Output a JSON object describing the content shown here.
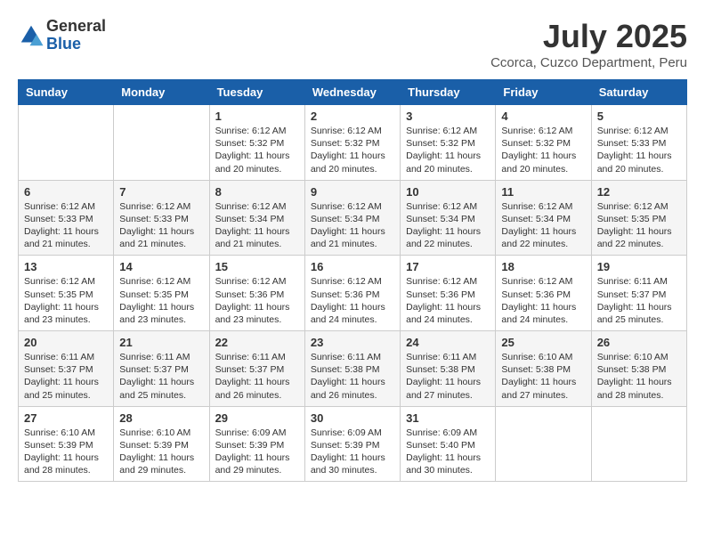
{
  "header": {
    "logo": {
      "general": "General",
      "blue": "Blue"
    },
    "month": "July 2025",
    "location": "Ccorca, Cuzco Department, Peru"
  },
  "weekdays": [
    "Sunday",
    "Monday",
    "Tuesday",
    "Wednesday",
    "Thursday",
    "Friday",
    "Saturday"
  ],
  "weeks": [
    [
      {
        "day": "",
        "info": ""
      },
      {
        "day": "",
        "info": ""
      },
      {
        "day": "1",
        "info": "Sunrise: 6:12 AM\nSunset: 5:32 PM\nDaylight: 11 hours and 20 minutes."
      },
      {
        "day": "2",
        "info": "Sunrise: 6:12 AM\nSunset: 5:32 PM\nDaylight: 11 hours and 20 minutes."
      },
      {
        "day": "3",
        "info": "Sunrise: 6:12 AM\nSunset: 5:32 PM\nDaylight: 11 hours and 20 minutes."
      },
      {
        "day": "4",
        "info": "Sunrise: 6:12 AM\nSunset: 5:32 PM\nDaylight: 11 hours and 20 minutes."
      },
      {
        "day": "5",
        "info": "Sunrise: 6:12 AM\nSunset: 5:33 PM\nDaylight: 11 hours and 20 minutes."
      }
    ],
    [
      {
        "day": "6",
        "info": "Sunrise: 6:12 AM\nSunset: 5:33 PM\nDaylight: 11 hours and 21 minutes."
      },
      {
        "day": "7",
        "info": "Sunrise: 6:12 AM\nSunset: 5:33 PM\nDaylight: 11 hours and 21 minutes."
      },
      {
        "day": "8",
        "info": "Sunrise: 6:12 AM\nSunset: 5:34 PM\nDaylight: 11 hours and 21 minutes."
      },
      {
        "day": "9",
        "info": "Sunrise: 6:12 AM\nSunset: 5:34 PM\nDaylight: 11 hours and 21 minutes."
      },
      {
        "day": "10",
        "info": "Sunrise: 6:12 AM\nSunset: 5:34 PM\nDaylight: 11 hours and 22 minutes."
      },
      {
        "day": "11",
        "info": "Sunrise: 6:12 AM\nSunset: 5:34 PM\nDaylight: 11 hours and 22 minutes."
      },
      {
        "day": "12",
        "info": "Sunrise: 6:12 AM\nSunset: 5:35 PM\nDaylight: 11 hours and 22 minutes."
      }
    ],
    [
      {
        "day": "13",
        "info": "Sunrise: 6:12 AM\nSunset: 5:35 PM\nDaylight: 11 hours and 23 minutes."
      },
      {
        "day": "14",
        "info": "Sunrise: 6:12 AM\nSunset: 5:35 PM\nDaylight: 11 hours and 23 minutes."
      },
      {
        "day": "15",
        "info": "Sunrise: 6:12 AM\nSunset: 5:36 PM\nDaylight: 11 hours and 23 minutes."
      },
      {
        "day": "16",
        "info": "Sunrise: 6:12 AM\nSunset: 5:36 PM\nDaylight: 11 hours and 24 minutes."
      },
      {
        "day": "17",
        "info": "Sunrise: 6:12 AM\nSunset: 5:36 PM\nDaylight: 11 hours and 24 minutes."
      },
      {
        "day": "18",
        "info": "Sunrise: 6:12 AM\nSunset: 5:36 PM\nDaylight: 11 hours and 24 minutes."
      },
      {
        "day": "19",
        "info": "Sunrise: 6:11 AM\nSunset: 5:37 PM\nDaylight: 11 hours and 25 minutes."
      }
    ],
    [
      {
        "day": "20",
        "info": "Sunrise: 6:11 AM\nSunset: 5:37 PM\nDaylight: 11 hours and 25 minutes."
      },
      {
        "day": "21",
        "info": "Sunrise: 6:11 AM\nSunset: 5:37 PM\nDaylight: 11 hours and 25 minutes."
      },
      {
        "day": "22",
        "info": "Sunrise: 6:11 AM\nSunset: 5:37 PM\nDaylight: 11 hours and 26 minutes."
      },
      {
        "day": "23",
        "info": "Sunrise: 6:11 AM\nSunset: 5:38 PM\nDaylight: 11 hours and 26 minutes."
      },
      {
        "day": "24",
        "info": "Sunrise: 6:11 AM\nSunset: 5:38 PM\nDaylight: 11 hours and 27 minutes."
      },
      {
        "day": "25",
        "info": "Sunrise: 6:10 AM\nSunset: 5:38 PM\nDaylight: 11 hours and 27 minutes."
      },
      {
        "day": "26",
        "info": "Sunrise: 6:10 AM\nSunset: 5:38 PM\nDaylight: 11 hours and 28 minutes."
      }
    ],
    [
      {
        "day": "27",
        "info": "Sunrise: 6:10 AM\nSunset: 5:39 PM\nDaylight: 11 hours and 28 minutes."
      },
      {
        "day": "28",
        "info": "Sunrise: 6:10 AM\nSunset: 5:39 PM\nDaylight: 11 hours and 29 minutes."
      },
      {
        "day": "29",
        "info": "Sunrise: 6:09 AM\nSunset: 5:39 PM\nDaylight: 11 hours and 29 minutes."
      },
      {
        "day": "30",
        "info": "Sunrise: 6:09 AM\nSunset: 5:39 PM\nDaylight: 11 hours and 30 minutes."
      },
      {
        "day": "31",
        "info": "Sunrise: 6:09 AM\nSunset: 5:40 PM\nDaylight: 11 hours and 30 minutes."
      },
      {
        "day": "",
        "info": ""
      },
      {
        "day": "",
        "info": ""
      }
    ]
  ]
}
